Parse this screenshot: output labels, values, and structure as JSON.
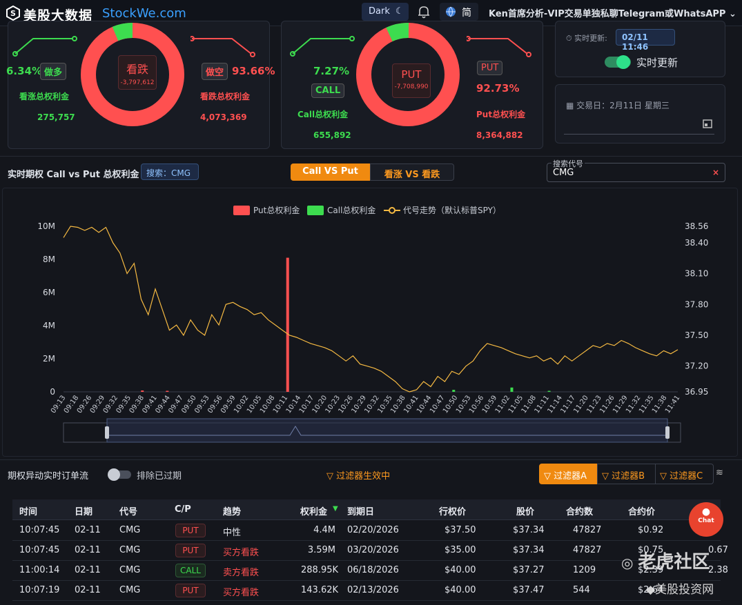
{
  "header": {
    "brand": "美股大数据",
    "brand_en": "StockWe.com",
    "dark_label": "Dark",
    "lang_label": "简",
    "promo": "Ken首席分析-VIP交易单独私聊Telegram或WhatsAPP"
  },
  "panel1": {
    "left_pct": "6.34%",
    "left_tag": "做多",
    "left_title": "看涨总权利金",
    "left_value": "275,757",
    "center_label": "看跌",
    "center_value": "-3,797,612",
    "right_tag": "做空",
    "right_pct": "93.66%",
    "right_title": "看跌总权利金",
    "right_value": "4,073,369"
  },
  "panel2": {
    "left_pct": "7.27%",
    "left_tag": "CALL",
    "left_title": "Call总权利金",
    "left_value": "655,892",
    "center_label": "PUT",
    "center_value": "-7,708,990",
    "right_tag": "PUT",
    "right_pct": "92.73%",
    "right_title": "Put总权利金",
    "right_value": "8,364,882"
  },
  "panel3": {
    "update_label": "实时更新:",
    "update_time": "02/11 11:46",
    "toggle_label": "实时更新",
    "trade_day": "交易日：2月11日 星期三"
  },
  "chart_bar": {
    "title": "实时期权 Call vs Put 总权利金",
    "search_tag": "搜索：CMG",
    "tab1": "Call VS Put",
    "tab2": "看涨 VS 看跌",
    "search_label": "搜索代号",
    "search_value": "CMG"
  },
  "chart_data": {
    "type": "bar",
    "legend": [
      "Put总权利金",
      "Call总权利金",
      "代号走势（默认标普SPY）"
    ],
    "y_left_ticks": [
      "0",
      "2M",
      "4M",
      "6M",
      "8M",
      "10M"
    ],
    "y_left_range": [
      0,
      10000000
    ],
    "y_right_ticks": [
      "36.95",
      "37.20",
      "37.50",
      "37.80",
      "38.10",
      "38.40",
      "38.56"
    ],
    "y_right_range": [
      36.95,
      38.56
    ],
    "x_ticks": [
      "09:13",
      "09:18",
      "09:26",
      "09:29",
      "09:32",
      "09:35",
      "09:38",
      "09:41",
      "09:44",
      "09:47",
      "09:50",
      "09:53",
      "09:56",
      "09:59",
      "10:02",
      "10:05",
      "10:08",
      "10:11",
      "10:14",
      "10:17",
      "10:20",
      "10:23",
      "10:26",
      "10:29",
      "10:32",
      "10:35",
      "10:38",
      "10:41",
      "10:44",
      "10:47",
      "10:50",
      "10:53",
      "10:56",
      "10:59",
      "11:02",
      "11:05",
      "11:08",
      "11:11",
      "11:14",
      "11:17",
      "11:20",
      "11:23",
      "11:26",
      "11:29",
      "11:32",
      "11:35",
      "11:38",
      "11:41"
    ],
    "put_bars": [
      {
        "x": "09:32",
        "value": 80000
      },
      {
        "x": "09:38",
        "value": 60000
      },
      {
        "x": "10:07",
        "value": 8100000
      }
    ],
    "call_bars": [
      {
        "x": "10:47",
        "value": 120000
      },
      {
        "x": "11:01",
        "value": 260000
      },
      {
        "x": "11:10",
        "value": 60000
      }
    ],
    "price_line": [
      38.45,
      38.56,
      38.55,
      38.52,
      38.55,
      38.5,
      38.55,
      38.4,
      38.3,
      38.1,
      38.2,
      37.85,
      37.7,
      37.95,
      37.75,
      37.55,
      37.6,
      37.5,
      37.65,
      37.55,
      37.5,
      37.7,
      37.6,
      37.8,
      37.82,
      37.78,
      37.75,
      37.7,
      37.72,
      37.65,
      37.6,
      37.55,
      37.5,
      37.48,
      37.45,
      37.42,
      37.4,
      37.38,
      37.35,
      37.3,
      37.25,
      37.3,
      37.22,
      37.2,
      37.18,
      37.15,
      37.1,
      37.05,
      36.98,
      36.95,
      36.97,
      37.05,
      37.0,
      37.1,
      37.05,
      37.15,
      37.12,
      37.2,
      37.25,
      37.35,
      37.42,
      37.4,
      37.38,
      37.35,
      37.32,
      37.3,
      37.28,
      37.3,
      37.25,
      37.28,
      37.22,
      37.3,
      37.25,
      37.3,
      37.35,
      37.4,
      37.38,
      37.42,
      37.4,
      37.45,
      37.42,
      37.38,
      37.35,
      37.32,
      37.3,
      37.35,
      37.32,
      37.36
    ]
  },
  "orderflow": {
    "title": "期权异动实时订单流",
    "exclude_label": "排除已过期",
    "filter_active": "过滤器生效中",
    "filterA": "过滤器A",
    "filterB": "过滤器B",
    "filterC": "过滤器C"
  },
  "table": {
    "headers": [
      "时间",
      "日期",
      "代号",
      "C/P",
      "趋势",
      "权利金",
      "到期日",
      "行权价",
      "股价",
      "合约数",
      "合约价"
    ],
    "rows": [
      {
        "time": "10:07:45",
        "date": "02-11",
        "sym": "CMG",
        "cp": "PUT",
        "trend": "中性",
        "prem": "4.4M",
        "exp": "02/20/2026",
        "strike": "$37.50",
        "px": "$37.34",
        "qty": "47827",
        "cprice": "$0.92",
        "extra": ""
      },
      {
        "time": "10:07:45",
        "date": "02-11",
        "sym": "CMG",
        "cp": "PUT",
        "trend": "买方看跌",
        "prem": "3.59M",
        "exp": "03/20/2026",
        "strike": "$35.00",
        "px": "$37.34",
        "qty": "47827",
        "cprice": "$0.75",
        "extra": "0.67"
      },
      {
        "time": "11:00:14",
        "date": "02-11",
        "sym": "CMG",
        "cp": "CALL",
        "trend": "卖方看跌",
        "prem": "288.95K",
        "exp": "06/18/2026",
        "strike": "$40.00",
        "px": "$37.27",
        "qty": "1209",
        "cprice": "$2.39",
        "extra": "2.38"
      },
      {
        "time": "10:07:19",
        "date": "02-11",
        "sym": "CMG",
        "cp": "PUT",
        "trend": "买方看跌",
        "prem": "143.62K",
        "exp": "02/13/2026",
        "strike": "$40.00",
        "px": "$37.47",
        "qty": "544",
        "cprice": "$2.64",
        "extra": ""
      }
    ]
  },
  "chat": {
    "label": "Chat"
  },
  "watermark": {
    "line1": "老虎社区",
    "line2": "美股投资网"
  },
  "colors": {
    "put": "#ff5050",
    "call": "#3ddc4f",
    "price": "#f5b942",
    "accent": "#f08a10"
  }
}
